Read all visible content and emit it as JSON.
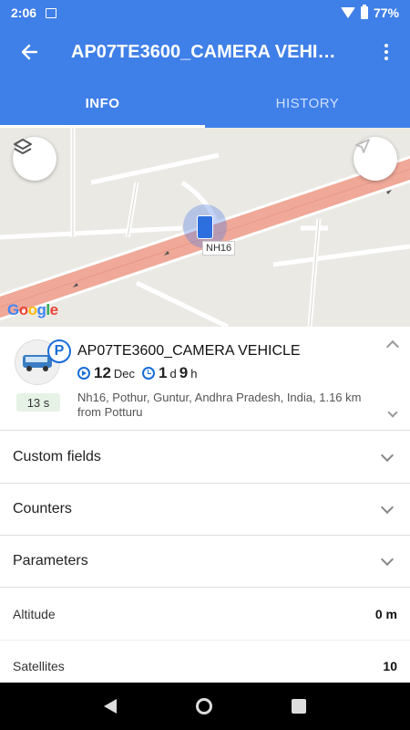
{
  "status_bar": {
    "time": "2:06",
    "battery": "77%"
  },
  "toolbar": {
    "title": "AP07TE3600_CAMERA VEHICLE"
  },
  "tabs": [
    {
      "label": "INFO",
      "active": true
    },
    {
      "label": "HISTORY",
      "active": false
    }
  ],
  "map": {
    "road_label": "NH16",
    "attribution": "Google"
  },
  "vehicle": {
    "name": "AP07TE3600_CAMERA VEHICLE",
    "status_badge": "P",
    "age": "13 s",
    "date_day": "12",
    "date_month": "Dec",
    "duration_days": "1",
    "duration_days_unit": "d",
    "duration_hours": "9",
    "duration_hours_unit": "h",
    "address": "Nh16, Pothur, Guntur, Andhra Pradesh, India, 1.16 km from Potturu"
  },
  "sections": [
    {
      "label": "Custom fields"
    },
    {
      "label": "Counters"
    },
    {
      "label": "Parameters"
    }
  ],
  "parameters": [
    {
      "label": "Altitude",
      "value": "0 m"
    },
    {
      "label": "Satellites",
      "value": "10"
    }
  ],
  "colors": {
    "primary": "#3f7fe8",
    "accent": "#1a6dd6",
    "road": "#f0a898"
  },
  "icons": {
    "back": "arrow-left-icon",
    "menu": "more-vert-icon",
    "layers": "layers-icon",
    "locate": "navigation-arrow-icon"
  }
}
